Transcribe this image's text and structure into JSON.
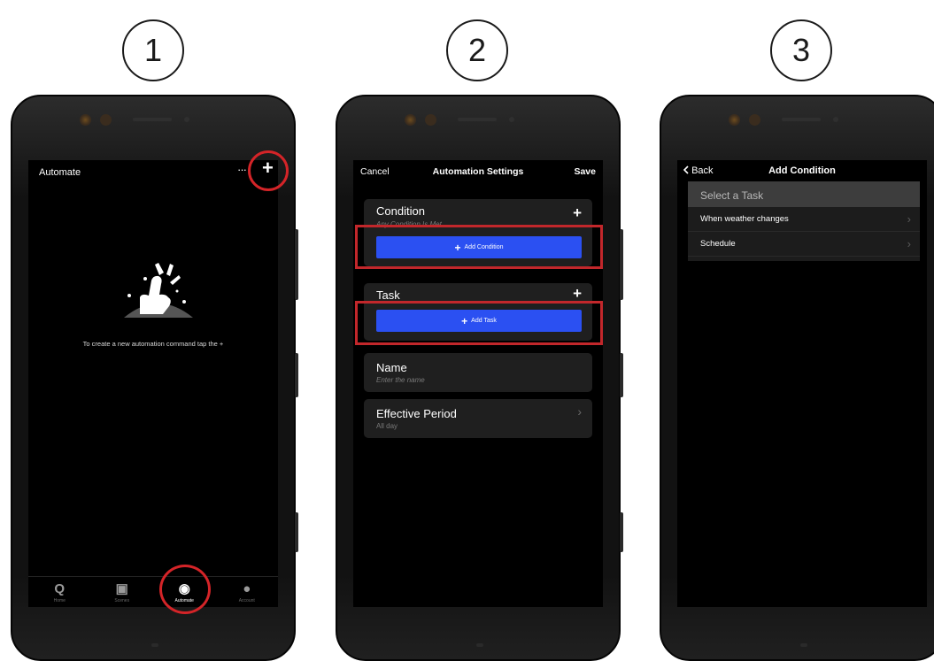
{
  "steps": [
    "1",
    "2",
    "3"
  ],
  "screen1": {
    "title": "Automate",
    "more_glyph": "···",
    "add_glyph": "+",
    "empty_message": "To create a new automation command tap the +",
    "tabs": [
      {
        "icon": "Q",
        "label": "Home",
        "active": false
      },
      {
        "icon": "▣",
        "label": "Scenes",
        "active": false
      },
      {
        "icon": "◉",
        "label": "Automate",
        "active": true
      },
      {
        "icon": "●",
        "label": "Account",
        "active": false
      }
    ]
  },
  "screen2": {
    "cancel_label": "Cancel",
    "title": "Automation Settings",
    "save_label": "Save",
    "condition": {
      "title": "Condition",
      "subtitle": "Any Condition Is Met",
      "add_button_label": "Add Condition"
    },
    "task": {
      "title": "Task",
      "add_button_label": "Add Task"
    },
    "name": {
      "title": "Name",
      "placeholder": "Enter the name"
    },
    "effective_period": {
      "title": "Effective Period",
      "value": "All day"
    },
    "plus_glyph": "+",
    "chevron_glyph": "›"
  },
  "screen3": {
    "back_label": "Back",
    "title": "Add Condition",
    "list_header": "Select a Task",
    "options": [
      "When weather changes",
      "Schedule"
    ],
    "chevron_glyph": "›"
  },
  "colors": {
    "accent_blue": "#2b50f2",
    "highlight_red": "#d42428",
    "screen_bg": "#000000",
    "card_bg": "#1f1f1f"
  }
}
